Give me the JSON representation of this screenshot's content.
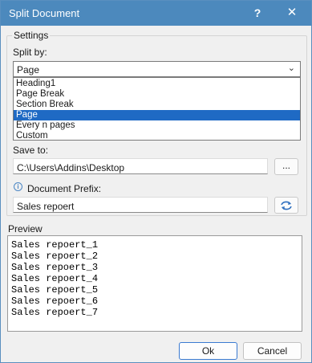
{
  "window": {
    "title": "Split Document",
    "help_label": "?",
    "close_label": "✕"
  },
  "settings": {
    "legend": "Settings",
    "split_by_label": "Split by:",
    "split_by_value": "Page",
    "options": [
      "Heading1",
      "Page Break",
      "Section Break",
      "Page",
      "Every n pages",
      "Custom"
    ],
    "selected_index": 3,
    "save_to_label": "Save to:",
    "save_to_value": "C:\\Users\\Addins\\Desktop",
    "browse_label": "...",
    "prefix_label": "Document Prefix:",
    "prefix_value": "Sales repoert"
  },
  "preview": {
    "legend": "Preview",
    "lines": [
      "Sales repoert_1",
      "Sales repoert_2",
      "Sales repoert_3",
      "Sales repoert_4",
      "Sales repoert_5",
      "Sales repoert_6",
      "Sales repoert_7"
    ]
  },
  "buttons": {
    "ok": "Ok",
    "cancel": "Cancel"
  },
  "icons": {
    "info": "info-icon",
    "refresh": "refresh-icon",
    "chevron": "chevron-down-icon"
  },
  "colors": {
    "titlebar": "#4c89bd",
    "selection": "#1f6ac4"
  }
}
